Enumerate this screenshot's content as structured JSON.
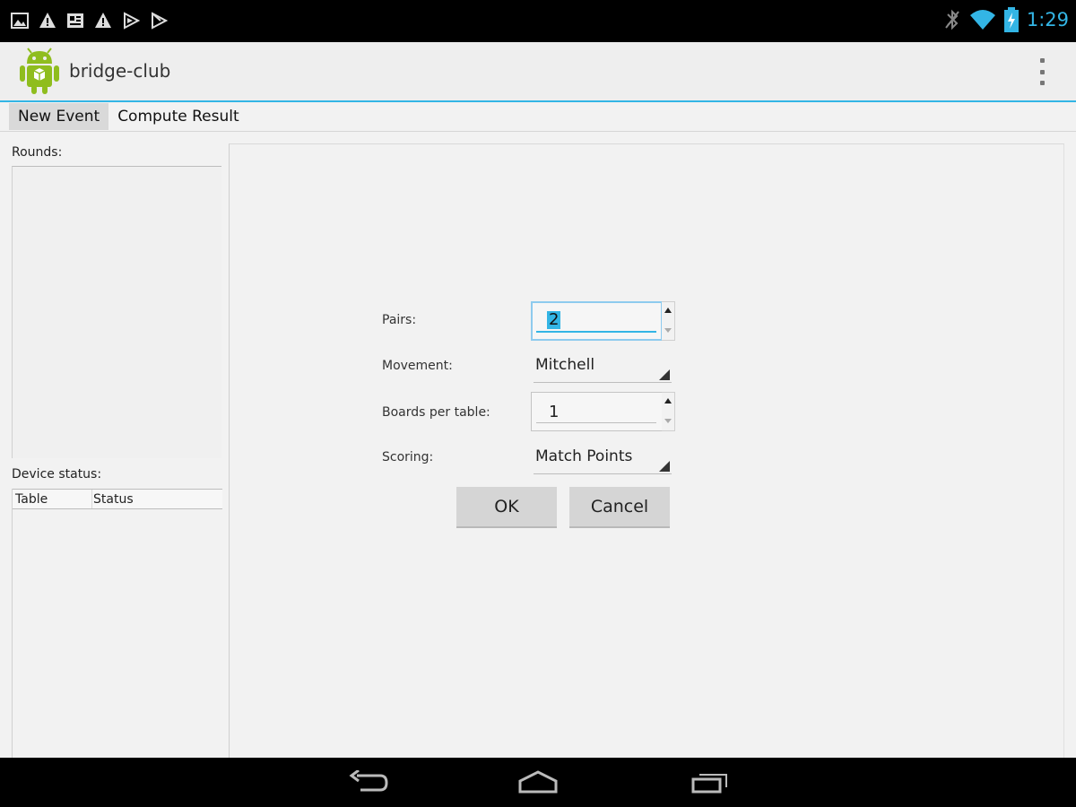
{
  "status_bar": {
    "notifications": [
      "gallery-icon",
      "warning-icon",
      "news-icon",
      "warning-icon",
      "play-icon",
      "play-store-icon"
    ],
    "time": "1:29",
    "colors": {
      "accent": "#33b5e5"
    }
  },
  "action_bar": {
    "app_title": "bridge-club",
    "logo": "android-icon",
    "overflow": "overflow-menu-icon"
  },
  "tabs": [
    {
      "label": "New Event",
      "active": true
    },
    {
      "label": "Compute Result",
      "active": false
    }
  ],
  "left_panel": {
    "rounds_label": "Rounds:",
    "device_status_label": "Device status:",
    "device_table": {
      "columns": [
        "Table",
        "Status"
      ],
      "rows": []
    }
  },
  "form": {
    "pairs": {
      "label": "Pairs:",
      "value": "2"
    },
    "movement": {
      "label": "Movement:",
      "value": "Mitchell"
    },
    "boards_per_table": {
      "label": "Boards per table:",
      "value": "1"
    },
    "scoring": {
      "label": "Scoring:",
      "value": "Match Points"
    },
    "ok_label": "OK",
    "cancel_label": "Cancel"
  },
  "nav_bar": {
    "icons": [
      "back-icon",
      "home-icon",
      "recents-icon"
    ]
  }
}
